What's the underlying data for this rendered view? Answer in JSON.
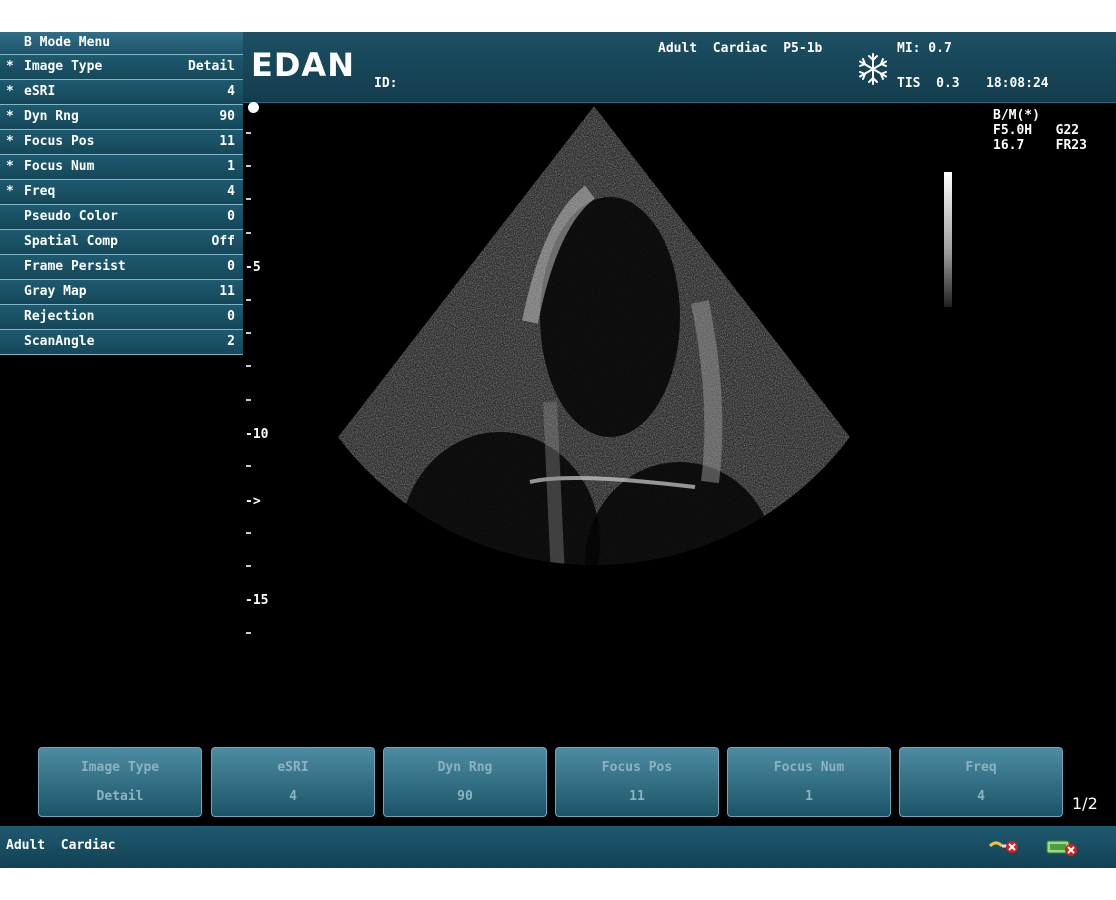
{
  "header": {
    "brand": "EDAN",
    "id_label": "ID:",
    "probe": "Adult  Cardiac  P5-1b",
    "mi": "MI: 0.7",
    "tis": "TIS  0.3",
    "time": "18:08:24",
    "freeze_icon": "snowflake-icon"
  },
  "menu": {
    "title": "B  Mode  Menu",
    "items": [
      {
        "star": "*",
        "label": "Image  Type",
        "value": "Detail"
      },
      {
        "star": "*",
        "label": "eSRI",
        "value": "4"
      },
      {
        "star": "*",
        "label": "Dyn  Rng",
        "value": "90"
      },
      {
        "star": "*",
        "label": "Focus  Pos",
        "value": "11"
      },
      {
        "star": "*",
        "label": "Focus  Num",
        "value": "1"
      },
      {
        "star": "*",
        "label": "Freq",
        "value": "4"
      },
      {
        "star": "",
        "label": "Pseudo  Color",
        "value": "0"
      },
      {
        "star": "",
        "label": "Spatial  Comp",
        "value": "Off"
      },
      {
        "star": "",
        "label": "Frame  Persist",
        "value": "0"
      },
      {
        "star": "",
        "label": "Gray  Map",
        "value": "11"
      },
      {
        "star": "",
        "label": "Rejection",
        "value": "0"
      },
      {
        "star": "",
        "label": "ScanAngle",
        "value": "2"
      }
    ]
  },
  "scale": {
    "labels": [
      "-5",
      "-10",
      "->",
      "-15"
    ],
    "depth_ticks": [
      5,
      10,
      15
    ],
    "max_depth": 16.7,
    "focus_depth": 12
  },
  "image_info": {
    "mode": "B/M(*)",
    "freq": "F5.0H",
    "gain": "G22",
    "depth": "16.7",
    "frame_rate": "FR23"
  },
  "soft_buttons": [
    {
      "label": "Image  Type",
      "value": "Detail"
    },
    {
      "label": "eSRI",
      "value": "4"
    },
    {
      "label": "Dyn  Rng",
      "value": "90"
    },
    {
      "label": "Focus  Pos",
      "value": "11"
    },
    {
      "label": "Focus  Num",
      "value": "1"
    },
    {
      "label": "Freq",
      "value": "4"
    }
  ],
  "page_indicator": "1/2",
  "status": {
    "text": "Adult  Cardiac",
    "icons": [
      "probe-disconnected-icon",
      "network-disconnected-icon"
    ]
  },
  "colors": {
    "panel": "#154759",
    "header": "#1d4f63",
    "background": "#000000"
  }
}
